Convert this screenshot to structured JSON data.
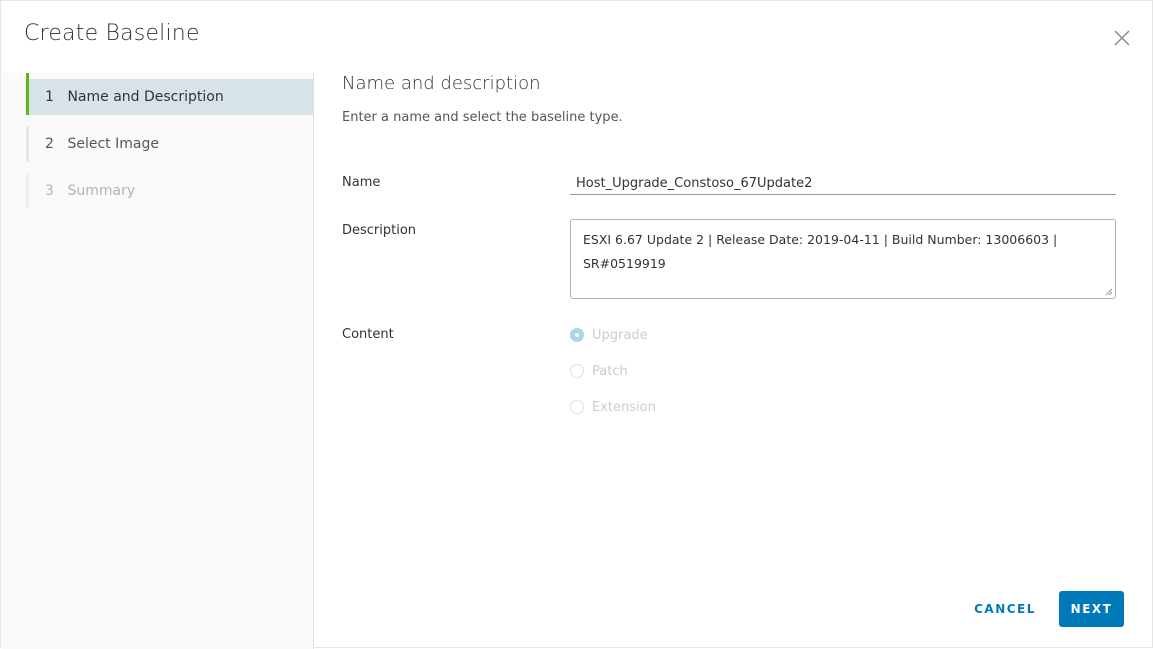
{
  "dialog": {
    "title": "Create Baseline",
    "close_icon": "close-icon"
  },
  "steps": [
    {
      "number": "1",
      "label": "Name and Description",
      "state": "active"
    },
    {
      "number": "2",
      "label": "Select Image",
      "state": "enabled"
    },
    {
      "number": "3",
      "label": "Summary",
      "state": "disabled"
    }
  ],
  "form": {
    "section_title": "Name and description",
    "section_subtitle": "Enter a name and select the baseline type.",
    "name_label": "Name",
    "name_value": "Host_Upgrade_Constoso_67Update2",
    "description_label": "Description",
    "description_value": "ESXI 6.67 Update 2 | Release Date: 2019-04-11 | Build Number: 13006603 | SR#0519919",
    "content_label": "Content",
    "content_options": [
      {
        "label": "Upgrade",
        "selected": true
      },
      {
        "label": "Patch",
        "selected": false
      },
      {
        "label": "Extension",
        "selected": false
      }
    ]
  },
  "footer": {
    "cancel_label": "CANCEL",
    "next_label": "NEXT"
  },
  "colors": {
    "accent": "#0079b8",
    "active_step_bar": "#5eb715",
    "active_step_bg": "#d8e3e9"
  }
}
